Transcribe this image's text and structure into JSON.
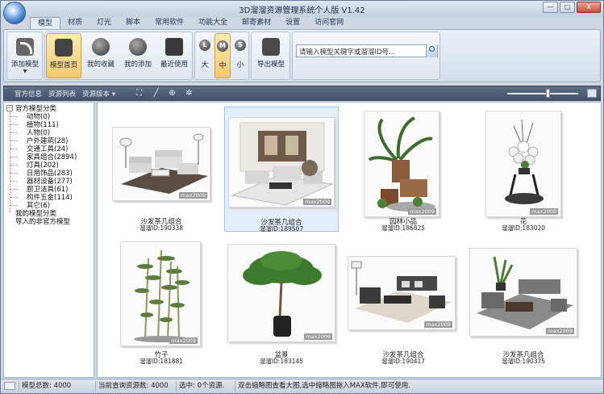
{
  "window": {
    "title": "3D溜溜资源管理系统个人版 V1.42",
    "min_label": "—",
    "max_label": "□",
    "close_label": "X"
  },
  "tabs": [
    {
      "label": "模型"
    },
    {
      "label": "材质"
    },
    {
      "label": "灯光"
    },
    {
      "label": "脚本"
    },
    {
      "label": "常用软件"
    },
    {
      "label": "功能大全"
    },
    {
      "label": "邮寄素材"
    },
    {
      "label": "设置"
    },
    {
      "label": "访问官网"
    }
  ],
  "ribbon": {
    "add_model": "添加模型",
    "model_home": "模型首页",
    "my_favorites": "我的收藏",
    "my_added": "我的添加",
    "recent": "最近使用",
    "size_large": "大",
    "size_medium": "中",
    "size_small": "小",
    "size_large_glyph": "L",
    "size_medium_glyph": "M",
    "size_small_glyph": "S",
    "export_model": "导出模型",
    "search_placeholder": "请输入模型关键字或溜溜ID号..."
  },
  "toolbar": {
    "official_info": "官方信息",
    "resource_list": "资源列表",
    "resource_version": "资源版本 ▾"
  },
  "tree": {
    "root": "官方模型分类",
    "children": [
      "动物(0)",
      "植物(111)",
      "人物(0)",
      "户外建筑(28)",
      "交通工具(24)",
      "家具组合(2894)",
      "灯具(202)",
      "日用饰品(283)",
      "器材设备(277)",
      "厨卫洁具(61)",
      "构件五金(114)",
      "其它(6)"
    ],
    "my_models": "我的模型分类",
    "imported": "导入的非官方模型"
  },
  "gallery": {
    "watermark": "max2009",
    "items": [
      {
        "name": "沙发茶几组合",
        "id": "溜溜ID:190338"
      },
      {
        "name": "沙发茶几组合",
        "id": "溜溜ID:189507"
      },
      {
        "name": "园林小品",
        "id": "溜溜ID:186825"
      },
      {
        "name": "花",
        "id": "溜溜ID:183020"
      },
      {
        "name": "竹子",
        "id": "溜溜ID:181881"
      },
      {
        "name": "盆景",
        "id": "溜溜ID:183145"
      },
      {
        "name": "沙发茶几组合",
        "id": "溜溜ID:190417"
      },
      {
        "name": "沙发茶几组合",
        "id": "溜溜ID:190375"
      }
    ]
  },
  "status": {
    "model_total": "模型总数: 4000",
    "current_query": "当前查询资源数: 4000",
    "selected": "选中: 0个资源.",
    "hint": "双击缩略图查看大图,选中缩略图拖入MAX软件,即可使用."
  },
  "colors": {
    "selected_tab": "#e4ebf4",
    "active_button": "#f6c870",
    "toolbar": "#4c5b72"
  }
}
